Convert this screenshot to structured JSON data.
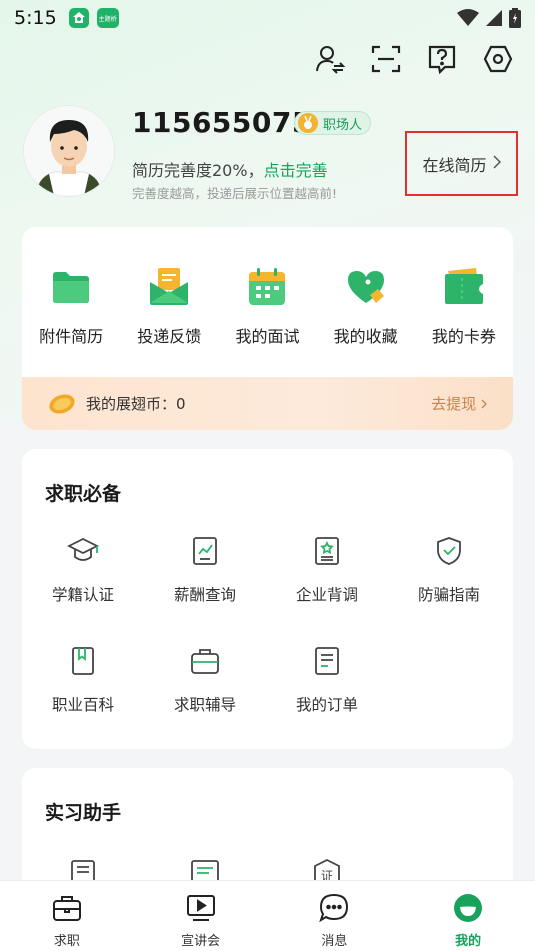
{
  "status_bar": {
    "time": "5:15",
    "app_badge_text": "主题桥"
  },
  "header": {
    "icons": [
      "switch-role-icon",
      "scan-icon",
      "help-icon",
      "settings-icon"
    ]
  },
  "profile": {
    "user_id": "115655075",
    "badge": "职场人",
    "completion_label": "简历完善度20%，",
    "completion_cta": "点击完善",
    "hint": "完善度越高，投递后展示位置越高前!",
    "online_resume": "在线简历"
  },
  "quick_actions": [
    {
      "label": "附件简历",
      "icon": "folder-icon"
    },
    {
      "label": "投递反馈",
      "icon": "envelope-icon"
    },
    {
      "label": "我的面试",
      "icon": "calendar-icon"
    },
    {
      "label": "我的收藏",
      "icon": "heart-icon"
    },
    {
      "label": "我的卡券",
      "icon": "ticket-icon"
    }
  ],
  "coins": {
    "label": "我的展翅币：0",
    "withdraw": "去提现"
  },
  "essentials": {
    "title": "求职必备",
    "items": [
      {
        "label": "学籍认证",
        "icon": "graduation-cap-icon"
      },
      {
        "label": "薪酬查询",
        "icon": "salary-chart-icon"
      },
      {
        "label": "企业背调",
        "icon": "company-check-icon"
      },
      {
        "label": "防骗指南",
        "icon": "shield-check-icon"
      },
      {
        "label": "职业百科",
        "icon": "book-icon"
      },
      {
        "label": "求职辅导",
        "icon": "briefcase-icon"
      },
      {
        "label": "我的订单",
        "icon": "order-icon"
      }
    ]
  },
  "intern": {
    "title": "实习助手",
    "cert_glyph": "证"
  },
  "bottom_nav": [
    {
      "label": "求职",
      "icon": "briefcase-nav-icon",
      "active": false
    },
    {
      "label": "宣讲会",
      "icon": "play-screen-icon",
      "active": false
    },
    {
      "label": "消息",
      "icon": "chat-icon",
      "active": false
    },
    {
      "label": "我的",
      "icon": "profile-nav-icon",
      "active": true
    }
  ],
  "colors": {
    "accent": "#17a35c",
    "highlight_box": "#e03030",
    "coin_text": "#c9824a"
  }
}
